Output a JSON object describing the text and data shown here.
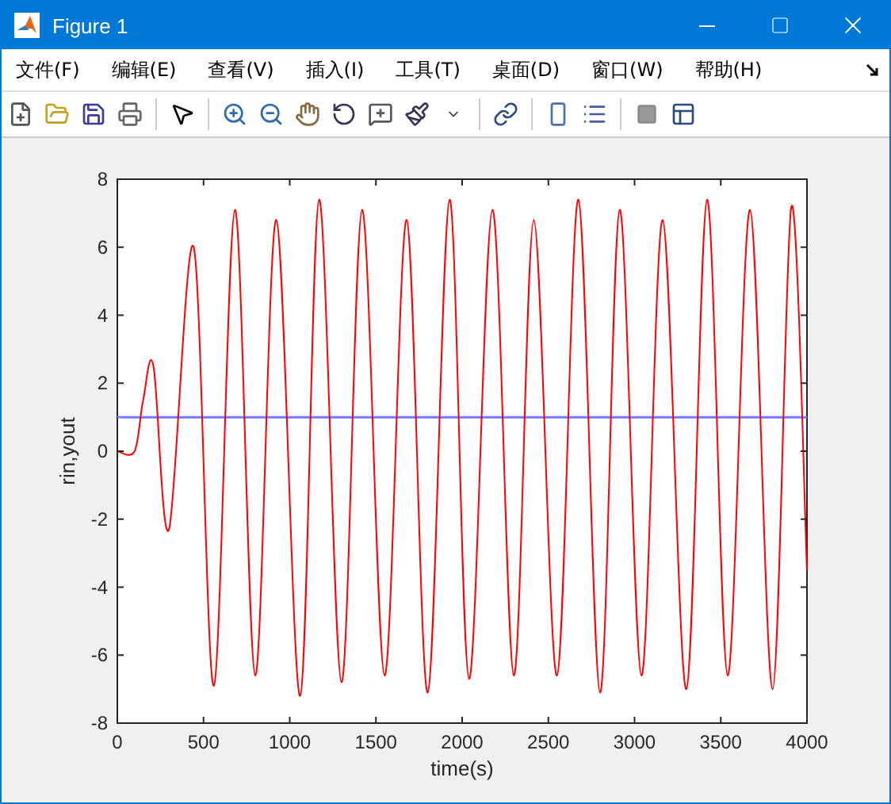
{
  "window": {
    "title": "Figure 1"
  },
  "menu": [
    "文件(F)",
    "编辑(E)",
    "查看(V)",
    "插入(I)",
    "工具(T)",
    "桌面(D)",
    "窗口(W)",
    "帮助(H)"
  ],
  "chart_data": {
    "type": "line",
    "xlabel": "time(s)",
    "ylabel": "rin,yout",
    "xlim": [
      0,
      4000
    ],
    "ylim": [
      -8,
      8
    ],
    "xticks": [
      0,
      500,
      1000,
      1500,
      2000,
      2500,
      3000,
      3500,
      4000
    ],
    "yticks": [
      -8,
      -6,
      -4,
      -2,
      0,
      2,
      4,
      6,
      8
    ],
    "x": [
      0,
      100,
      150,
      210,
      300,
      443,
      560,
      682,
      800,
      922,
      1060,
      1171,
      1300,
      1420,
      1550,
      1678,
      1800,
      1927,
      2040,
      2176,
      2300,
      2416,
      2550,
      2674,
      2800,
      2914,
      3040,
      3163,
      3300,
      3421,
      3540,
      3670,
      3800,
      3910,
      4000
    ],
    "series": [
      {
        "color": "#7777ff",
        "values": [
          1,
          1,
          1,
          1,
          1,
          1,
          1,
          1,
          1,
          1,
          1,
          1,
          1,
          1,
          1,
          1,
          1,
          1,
          1,
          1,
          1,
          1,
          1,
          1,
          1,
          1,
          1,
          1,
          1,
          1,
          1,
          1,
          1,
          1,
          1
        ]
      },
      {
        "color": "#ff0000",
        "values": [
          0,
          0,
          1.5,
          2.5,
          -2.3,
          6.0,
          -6.9,
          7.1,
          -6.6,
          6.8,
          -7.2,
          7.4,
          -6.8,
          7.1,
          -6.6,
          6.8,
          -7.1,
          7.4,
          -6.7,
          7.1,
          -6.6,
          6.8,
          -6.6,
          7.4,
          -7.1,
          7.1,
          -6.6,
          6.8,
          -7.0,
          7.4,
          -6.6,
          7.1,
          -7.0,
          7.2,
          -3.5
        ]
      }
    ]
  }
}
